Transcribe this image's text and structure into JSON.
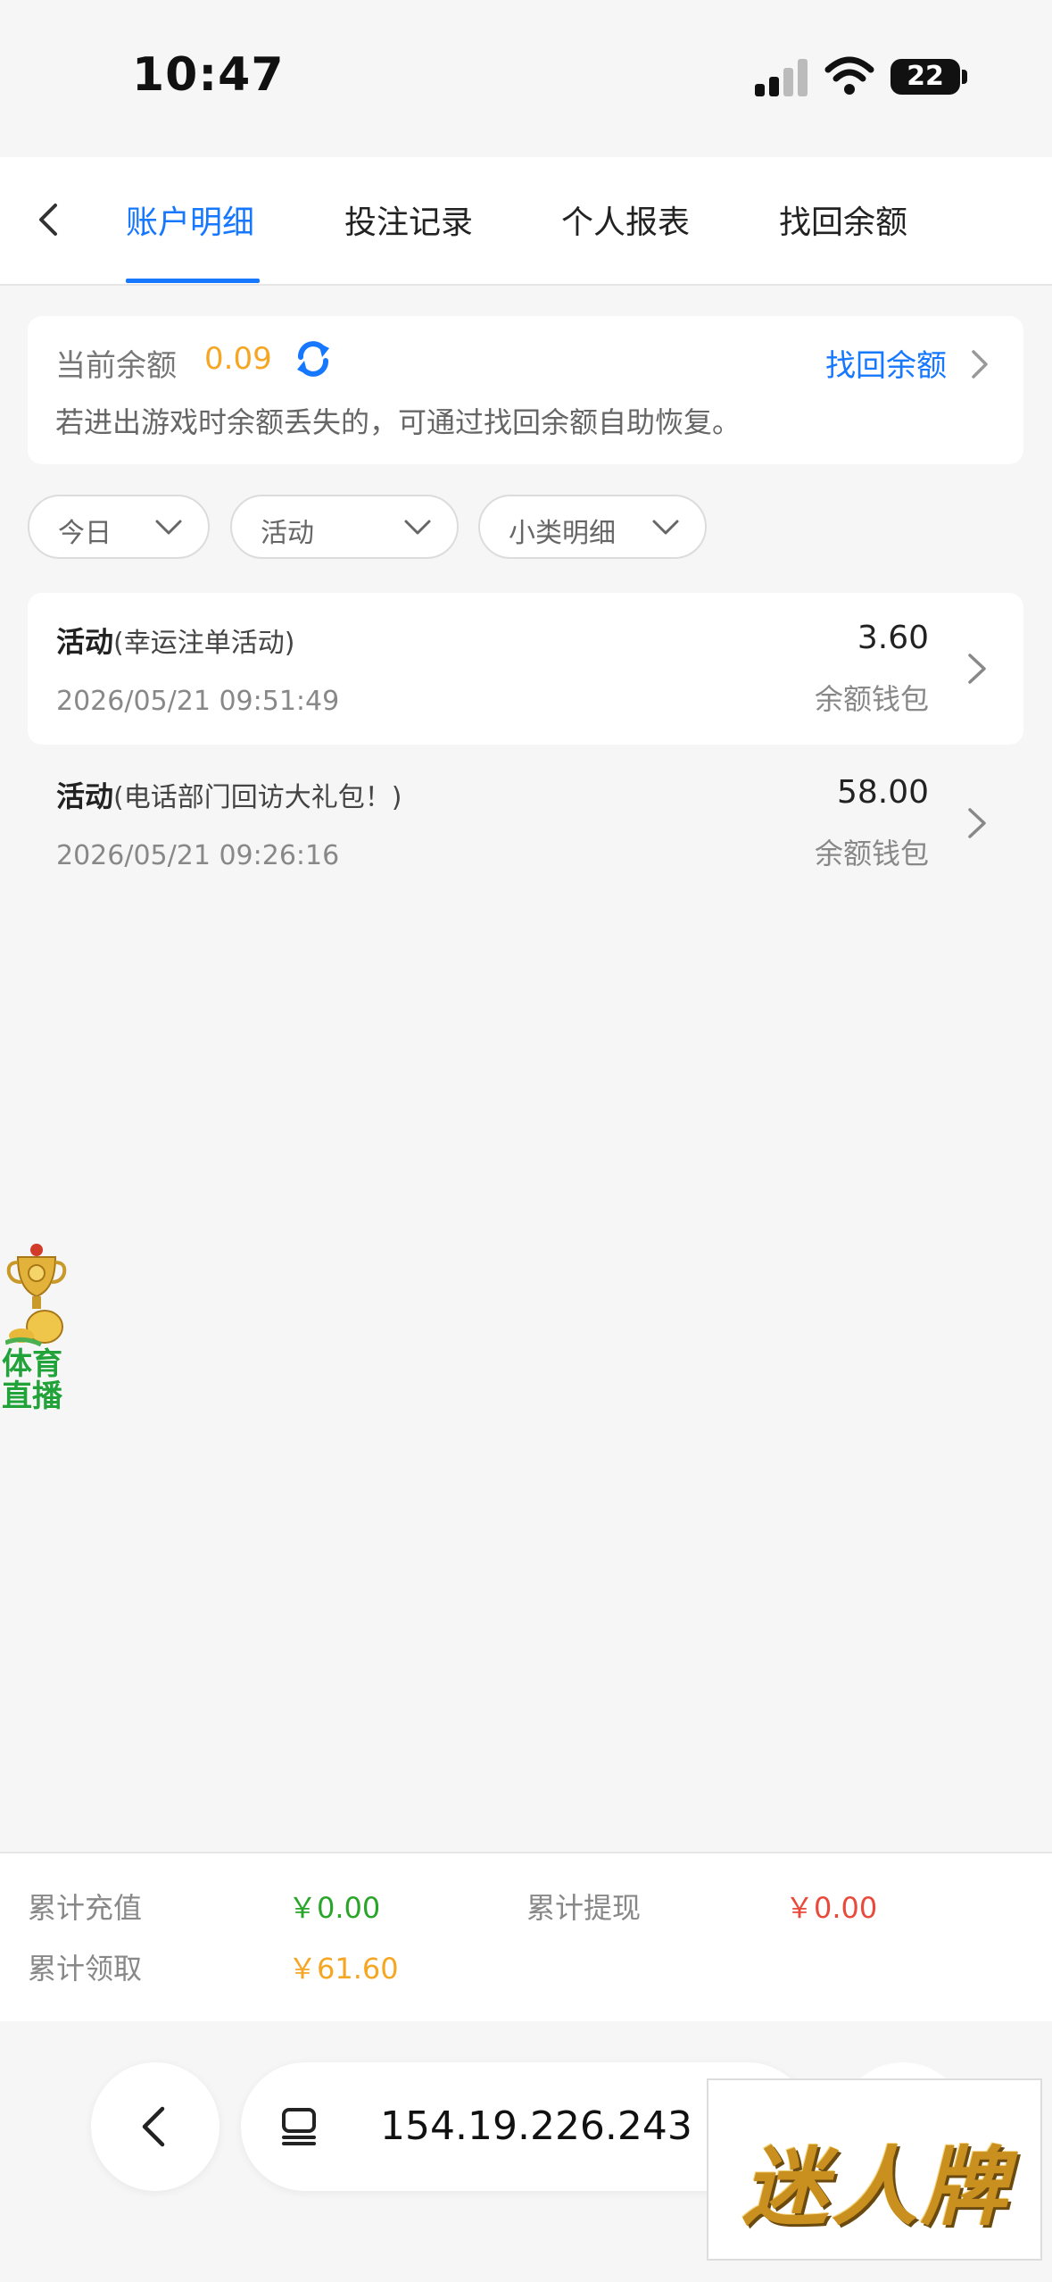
{
  "status_bar": {
    "time": "10:47",
    "battery": "22"
  },
  "tabs": [
    {
      "label": "账户明细",
      "active": true
    },
    {
      "label": "投注记录",
      "active": false
    },
    {
      "label": "个人报表",
      "active": false
    },
    {
      "label": "找回余额",
      "active": false
    }
  ],
  "balance": {
    "label": "当前余额",
    "value": "0.09",
    "recover_link": "找回余额",
    "note": "若进出游戏时余额丢失的，可通过找回余额自助恢复。"
  },
  "filters": [
    {
      "label": "今日"
    },
    {
      "label": "活动"
    },
    {
      "label": "小类明细"
    }
  ],
  "records": [
    {
      "type": "活动",
      "desc": "(幸运注单活动)",
      "time": "2026/05/21 09:51:49",
      "amount": "3.60",
      "wallet": "余额钱包"
    },
    {
      "type": "活动",
      "desc": "(电话部门回访大礼包！)",
      "time": "2026/05/21 09:26:16",
      "amount": "58.00",
      "wallet": "余额钱包"
    }
  ],
  "floating_widget": {
    "line1": "体育",
    "line2": "直播"
  },
  "summary": {
    "deposit_label": "累计充值",
    "deposit_value": "￥0.00",
    "withdraw_label": "累计提现",
    "withdraw_value": "￥0.00",
    "claim_label": "累计领取",
    "claim_value": "￥61.60"
  },
  "browser": {
    "url": "154.19.226.243"
  },
  "watermark": {
    "text": "迷人牌"
  },
  "colors": {
    "accent": "#1677ff",
    "balance": "#f5a623",
    "deposit": "#2aa52a",
    "withdraw": "#e84a3c",
    "claim": "#f5a623"
  }
}
